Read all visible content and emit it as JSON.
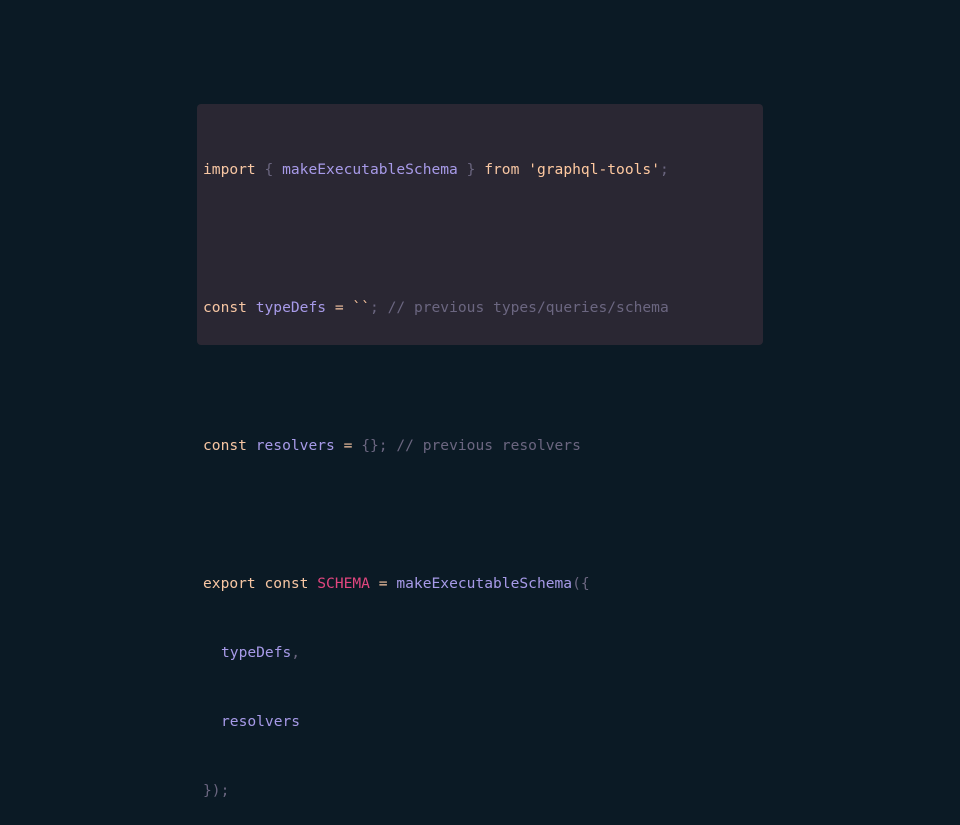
{
  "code": {
    "line1": {
      "kw_import": "import",
      "brace_open": "{",
      "ident": "makeExecutableSchema",
      "brace_close": "}",
      "kw_from": "from",
      "string": "'graphql-tools'",
      "semi": ";"
    },
    "line2": {
      "kw_const": "const",
      "ident": "typeDefs",
      "op": "=",
      "string": "``",
      "semi": ";",
      "comment": "// previous types/queries/schema"
    },
    "line3": {
      "kw_const": "const",
      "ident": "resolvers",
      "op": "=",
      "braces": "{}",
      "semi": ";",
      "comment": "// previous resolvers"
    },
    "line4": {
      "kw_export": "export",
      "kw_const": "const",
      "ident": "SCHEMA",
      "op": "=",
      "call": "makeExecutableSchema",
      "open": "({"
    },
    "line5": {
      "ident": "typeDefs",
      "comma": ","
    },
    "line6": {
      "ident": "resolvers"
    },
    "line7": {
      "close": "});"
    }
  },
  "colors": {
    "background": "#0b1a25",
    "code_background": "#2a2733",
    "keyword": "#f7c6a3",
    "identifier": "#a79ae8",
    "constant": "#e2467f",
    "comment": "#6b6680"
  }
}
